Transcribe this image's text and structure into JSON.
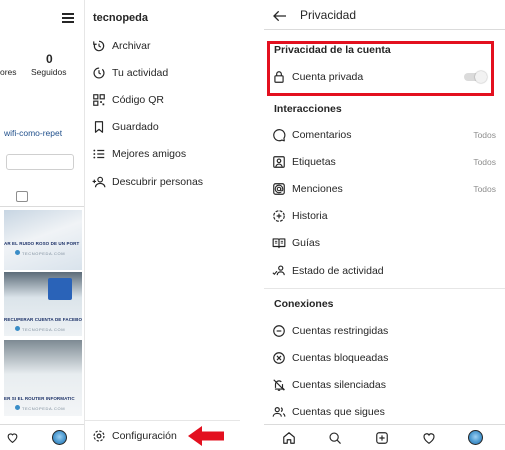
{
  "left_screen": {
    "profile": {
      "stats": [
        {
          "value": "",
          "label": "ores"
        },
        {
          "value": "0",
          "label": "Seguidos"
        }
      ],
      "bio_link": "wifi-como-repet",
      "post_captions": [
        "AR EL RUIDO ROSO DE UN PORT",
        "RECUPERAR CUENTA DE FACEBOO",
        "ER SI EL ROUTER INFORMATIC"
      ],
      "post_brand": "TECNOPEDA.COM"
    },
    "drawer": {
      "username": "tecnopeda",
      "items": [
        {
          "icon": "archive-icon",
          "label": "Archivar"
        },
        {
          "icon": "activity-icon",
          "label": "Tu actividad"
        },
        {
          "icon": "qr-code-icon",
          "label": "Código QR"
        },
        {
          "icon": "bookmark-icon",
          "label": "Guardado"
        },
        {
          "icon": "close-friends-list-icon",
          "label": "Mejores amigos"
        },
        {
          "icon": "add-person-icon",
          "label": "Descubrir personas"
        }
      ],
      "settings_label": "Configuración"
    },
    "highlight_color": "#e3101f"
  },
  "right_screen": {
    "title": "Privacidad",
    "account_privacy": {
      "section_title": "Privacidad de la cuenta",
      "private_account_label": "Cuenta privada",
      "private_account_enabled": false
    },
    "interactions": {
      "section_title": "Interacciones",
      "items": [
        {
          "icon": "comment-icon",
          "label": "Comentarios",
          "value": "Todos"
        },
        {
          "icon": "tag-person-icon",
          "label": "Etiquetas",
          "value": "Todos"
        },
        {
          "icon": "mention-icon",
          "label": "Menciones",
          "value": "Todos"
        },
        {
          "icon": "story-icon",
          "label": "Historia",
          "value": ""
        },
        {
          "icon": "guides-icon",
          "label": "Guías",
          "value": ""
        },
        {
          "icon": "activity-status-icon",
          "label": "Estado de actividad",
          "value": ""
        }
      ]
    },
    "connections": {
      "section_title": "Conexiones",
      "items": [
        {
          "icon": "restricted-icon",
          "label": "Cuentas restringidas"
        },
        {
          "icon": "blocked-icon",
          "label": "Cuentas bloqueadas"
        },
        {
          "icon": "muted-icon",
          "label": "Cuentas silenciadas"
        },
        {
          "icon": "following-icon",
          "label": "Cuentas que sigues"
        }
      ]
    },
    "bottom_nav": [
      "home-icon",
      "search-icon",
      "new-post-icon",
      "activity-heart-icon",
      "profile-avatar"
    ],
    "highlight_color": "#e3101f"
  }
}
